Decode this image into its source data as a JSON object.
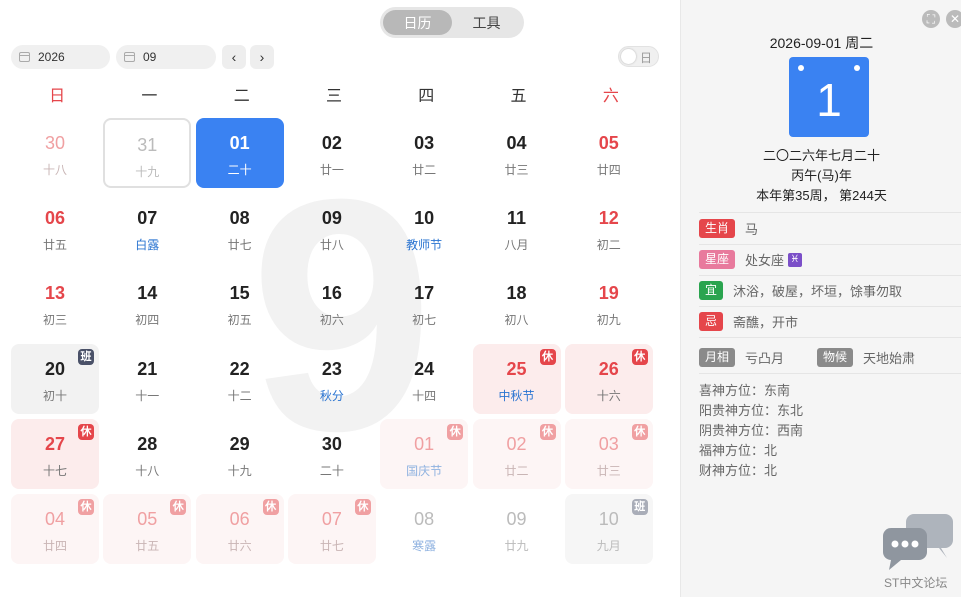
{
  "tabs": [
    {
      "label": "日历",
      "active": true
    },
    {
      "label": "工具",
      "active": false
    }
  ],
  "controls": {
    "year": "2026",
    "month": "09",
    "prev": "‹",
    "next": "›",
    "toggle_label": "日"
  },
  "weekdays": [
    "日",
    "一",
    "二",
    "三",
    "四",
    "五",
    "六"
  ],
  "watermark": "9",
  "days": [
    {
      "n": "30",
      "s": "十八",
      "st": "dimred"
    },
    {
      "n": "31",
      "s": "十九",
      "st": "dim today"
    },
    {
      "n": "01",
      "s": "二十",
      "st": "selected"
    },
    {
      "n": "02",
      "s": "廿一",
      "st": ""
    },
    {
      "n": "03",
      "s": "廿二",
      "st": ""
    },
    {
      "n": "04",
      "s": "廿三",
      "st": ""
    },
    {
      "n": "05",
      "s": "廿四",
      "st": "red"
    },
    {
      "n": "06",
      "s": "廿五",
      "st": "red"
    },
    {
      "n": "07",
      "s": "白露",
      "st": "",
      "fest": true
    },
    {
      "n": "08",
      "s": "廿七",
      "st": ""
    },
    {
      "n": "09",
      "s": "廿八",
      "st": ""
    },
    {
      "n": "10",
      "s": "教师节",
      "st": "",
      "fest": true
    },
    {
      "n": "11",
      "s": "八月",
      "st": ""
    },
    {
      "n": "12",
      "s": "初二",
      "st": "red"
    },
    {
      "n": "13",
      "s": "初三",
      "st": "red"
    },
    {
      "n": "14",
      "s": "初四",
      "st": ""
    },
    {
      "n": "15",
      "s": "初五",
      "st": ""
    },
    {
      "n": "16",
      "s": "初六",
      "st": ""
    },
    {
      "n": "17",
      "s": "初七",
      "st": ""
    },
    {
      "n": "18",
      "s": "初八",
      "st": ""
    },
    {
      "n": "19",
      "s": "初九",
      "st": "red"
    },
    {
      "n": "20",
      "s": "初十",
      "st": "work",
      "badge": "班"
    },
    {
      "n": "21",
      "s": "十一",
      "st": ""
    },
    {
      "n": "22",
      "s": "十二",
      "st": ""
    },
    {
      "n": "23",
      "s": "秋分",
      "st": "",
      "fest": true
    },
    {
      "n": "24",
      "s": "十四",
      "st": ""
    },
    {
      "n": "25",
      "s": "中秋节",
      "st": "red holiday",
      "fest": true,
      "badge": "休"
    },
    {
      "n": "26",
      "s": "十六",
      "st": "red holiday",
      "badge": "休"
    },
    {
      "n": "27",
      "s": "十七",
      "st": "red holiday",
      "badge": "休"
    },
    {
      "n": "28",
      "s": "十八",
      "st": ""
    },
    {
      "n": "29",
      "s": "十九",
      "st": ""
    },
    {
      "n": "30",
      "s": "二十",
      "st": ""
    },
    {
      "n": "01",
      "s": "国庆节",
      "st": "dimred dimholiday dimfest",
      "fest": true,
      "badge": "休"
    },
    {
      "n": "02",
      "s": "廿二",
      "st": "dimred dimholiday",
      "badge": "休"
    },
    {
      "n": "03",
      "s": "廿三",
      "st": "dimred dimholiday",
      "badge": "休"
    },
    {
      "n": "04",
      "s": "廿四",
      "st": "dimred dimholiday",
      "badge": "休"
    },
    {
      "n": "05",
      "s": "廿五",
      "st": "dimred dimholiday",
      "badge": "休"
    },
    {
      "n": "06",
      "s": "廿六",
      "st": "dimred dimholiday",
      "badge": "休"
    },
    {
      "n": "07",
      "s": "廿七",
      "st": "dimred dimholiday",
      "badge": "休"
    },
    {
      "n": "08",
      "s": "寒露",
      "st": "dim dimfest",
      "fest": true
    },
    {
      "n": "09",
      "s": "廿九",
      "st": "dim"
    },
    {
      "n": "10",
      "s": "九月",
      "st": "dim dimwork",
      "badge": "班"
    }
  ],
  "panel": {
    "date_header": "2026-09-01 周二",
    "big_day": "1",
    "lunar": "二〇二六年七月二十",
    "ganzhi": "丙午(马)年",
    "week_info": "本年第35周， 第244天",
    "shengxiao_tag": "生肖",
    "shengxiao": "马",
    "xingzuo_tag": "星座",
    "xingzuo": "处女座",
    "xingzuo_symbol": "♓",
    "yi_tag": "宜",
    "yi": "沐浴，破屋，坏垣，馀事勿取",
    "ji_tag": "忌",
    "ji": "斋醮，开市",
    "yuexiang_tag": "月相",
    "yuexiang": "亏凸月",
    "wuhou_tag": "物候",
    "wuhou": "天地始肃",
    "directions": [
      "喜神方位：东南",
      "阳贵神方位：东北",
      "阴贵神方位：西南",
      "福神方位：北",
      "财神方位：北"
    ],
    "forum_label": "ST中文论坛"
  },
  "colors": {
    "accent": "#3a82f2",
    "holiday_red": "#e5464b"
  }
}
